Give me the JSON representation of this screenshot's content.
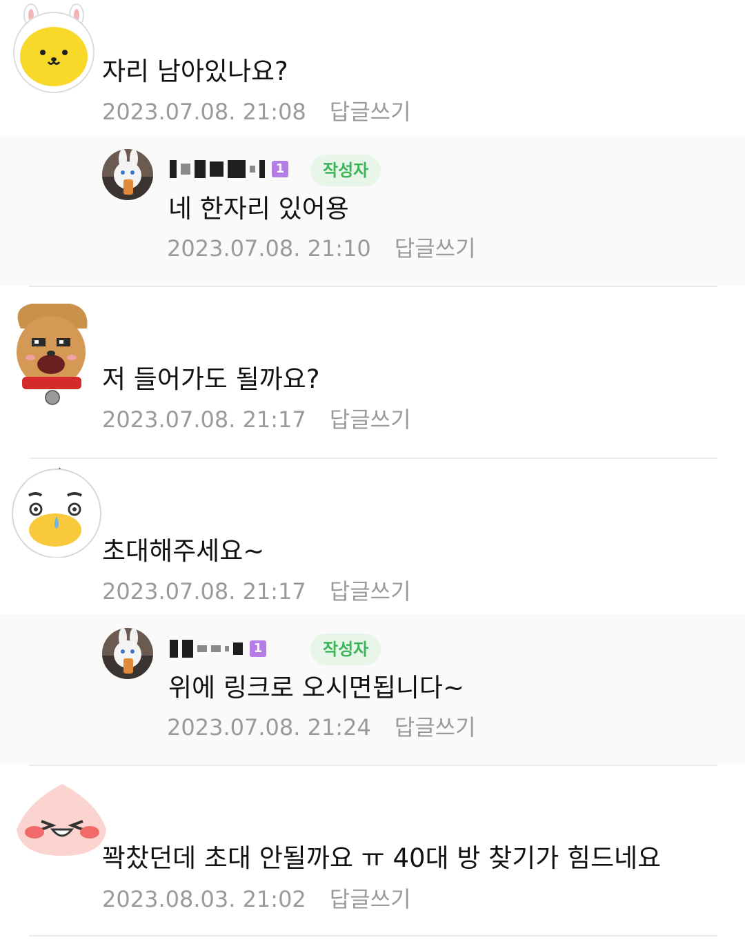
{
  "comments": [
    {
      "text": "자리 남아있나요?",
      "date": "2023.07.08. 21:08",
      "reply_label": "답글쓰기",
      "avatar": "yellow-bunny-hood-avatar",
      "replies": [
        {
          "author_badge": "작성자",
          "level": "1",
          "text": "네 한자리 있어용",
          "date": "2023.07.08. 21:10",
          "reply_label": "답글쓰기",
          "avatar": "white-rabbit-avatar"
        }
      ]
    },
    {
      "text": "저 들어가도 될까요?",
      "date": "2023.07.08. 21:17",
      "reply_label": "답글쓰기",
      "avatar": "brown-dog-avatar",
      "replies": []
    },
    {
      "text": "초대해주세요~",
      "date": "2023.07.08. 21:17",
      "reply_label": "답글쓰기",
      "avatar": "white-duck-avatar",
      "replies": [
        {
          "author_badge": "작성자",
          "level": "1",
          "text": "위에 링크로 오시면됩니다~",
          "date": "2023.07.08. 21:24",
          "reply_label": "답글쓰기",
          "avatar": "white-rabbit-avatar"
        }
      ]
    },
    {
      "text": "꽉찼던데 초대 안될까요 ㅠ 40대 방 찾기가 힘드네요",
      "date": "2023.08.03. 21:02",
      "reply_label": "답글쓰기",
      "avatar": "peach-avatar",
      "replies": []
    }
  ],
  "colors": {
    "badge_text": "#3db35a",
    "badge_bg": "#e8f6ea",
    "meta_text": "#9a9a9a",
    "reply_bg": "#f9faf9",
    "level_badge": "#b47de6"
  }
}
